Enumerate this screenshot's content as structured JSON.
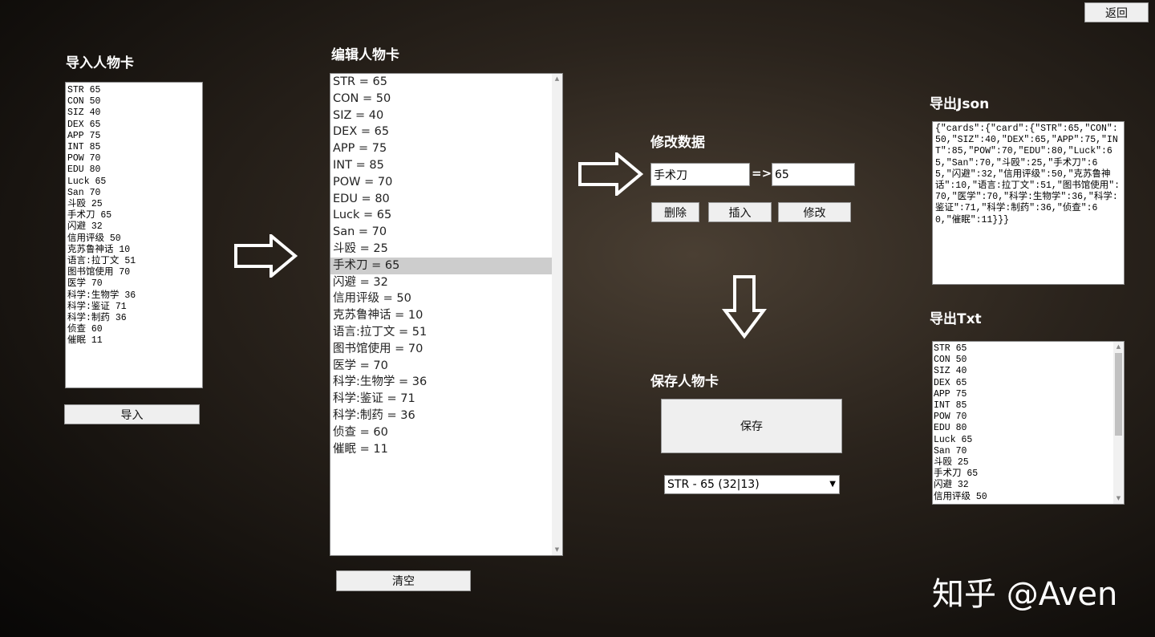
{
  "back_label": "返回",
  "import": {
    "title": "导入人物卡",
    "button": "导入"
  },
  "edit": {
    "title": "编辑人物卡",
    "clear": "清空",
    "selected_index": 11
  },
  "modify": {
    "title": "修改数据",
    "key": "手术刀",
    "arrow": "=>",
    "value": "65",
    "delete": "删除",
    "insert": "插入",
    "update": "修改"
  },
  "save": {
    "title": "保存人物卡",
    "button": "保存",
    "select_value": "STR - 65 (32|13)"
  },
  "export_json": {
    "title": "导出Json",
    "text": "{\"cards\":{\"card\":{\"STR\":65,\"CON\":50,\"SIZ\":40,\"DEX\":65,\"APP\":75,\"INT\":85,\"POW\":70,\"EDU\":80,\"Luck\":65,\"San\":70,\"斗殴\":25,\"手术刀\":65,\"闪避\":32,\"信用评级\":50,\"克苏鲁神话\":10,\"语言:拉丁文\":51,\"图书馆使用\":70,\"医学\":70,\"科学:生物学\":36,\"科学:鉴证\":71,\"科学:制药\":36,\"侦查\":60,\"催眠\":11}}}"
  },
  "export_txt": {
    "title": "导出Txt"
  },
  "stats": [
    {
      "name": "STR",
      "value": "65"
    },
    {
      "name": "CON",
      "value": "50"
    },
    {
      "name": "SIZ",
      "value": "40"
    },
    {
      "name": "DEX",
      "value": "65"
    },
    {
      "name": "APP",
      "value": "75"
    },
    {
      "name": "INT",
      "value": "85"
    },
    {
      "name": "POW",
      "value": "70"
    },
    {
      "name": "EDU",
      "value": "80"
    },
    {
      "name": "Luck",
      "value": "65"
    },
    {
      "name": "San",
      "value": "70"
    },
    {
      "name": "斗殴",
      "value": "25"
    },
    {
      "name": "手术刀",
      "value": "65"
    },
    {
      "name": "闪避",
      "value": "32"
    },
    {
      "name": "信用评级",
      "value": "50"
    },
    {
      "name": "克苏鲁神话",
      "value": "10"
    },
    {
      "name": "语言:拉丁文",
      "value": "51"
    },
    {
      "name": "图书馆使用",
      "value": "70"
    },
    {
      "name": "医学",
      "value": "70"
    },
    {
      "name": "科学:生物学",
      "value": "36"
    },
    {
      "name": "科学:鉴证",
      "value": "71"
    },
    {
      "name": "科学:制药",
      "value": "36"
    },
    {
      "name": "侦查",
      "value": "60"
    },
    {
      "name": "催眠",
      "value": "11"
    }
  ],
  "watermark": "知乎 @Aven"
}
